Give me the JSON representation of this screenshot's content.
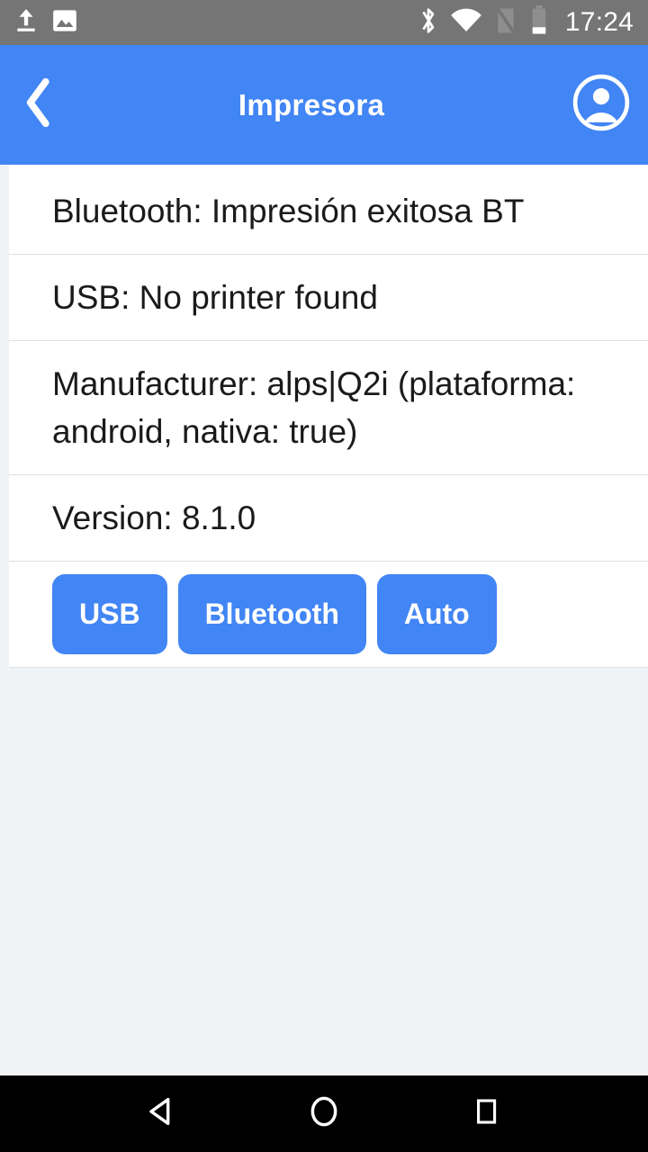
{
  "status_bar": {
    "time": "17:24",
    "left_icons": [
      "upload-icon",
      "image-icon"
    ],
    "right_icons": [
      "bluetooth-icon",
      "wifi-icon",
      "no-sim-signal-icon",
      "battery-low-icon"
    ],
    "background_color": "#757575"
  },
  "app_bar": {
    "title": "Impresora",
    "back_icon": "chevron-left-icon",
    "account_icon": "account-circle-icon",
    "background_color": "#4285f4",
    "text_color": "#ffffff"
  },
  "content": {
    "rows": [
      {
        "text": "Bluetooth: Impresión exitosa BT"
      },
      {
        "text": "USB: No printer found"
      },
      {
        "text": "Manufacturer: alps|Q2i (plataforma: android, nativa: true)"
      },
      {
        "text": "Version: 8.1.0"
      }
    ],
    "buttons": [
      {
        "label": "USB"
      },
      {
        "label": "Bluetooth"
      },
      {
        "label": "Auto"
      }
    ],
    "button_color": "#4285f4",
    "card_background": "#ffffff",
    "page_background": "#eff3f6"
  },
  "nav_bar": {
    "back_icon": "nav-back-triangle-icon",
    "home_icon": "nav-home-circle-icon",
    "recents_icon": "nav-recents-square-icon",
    "background_color": "#000000"
  }
}
